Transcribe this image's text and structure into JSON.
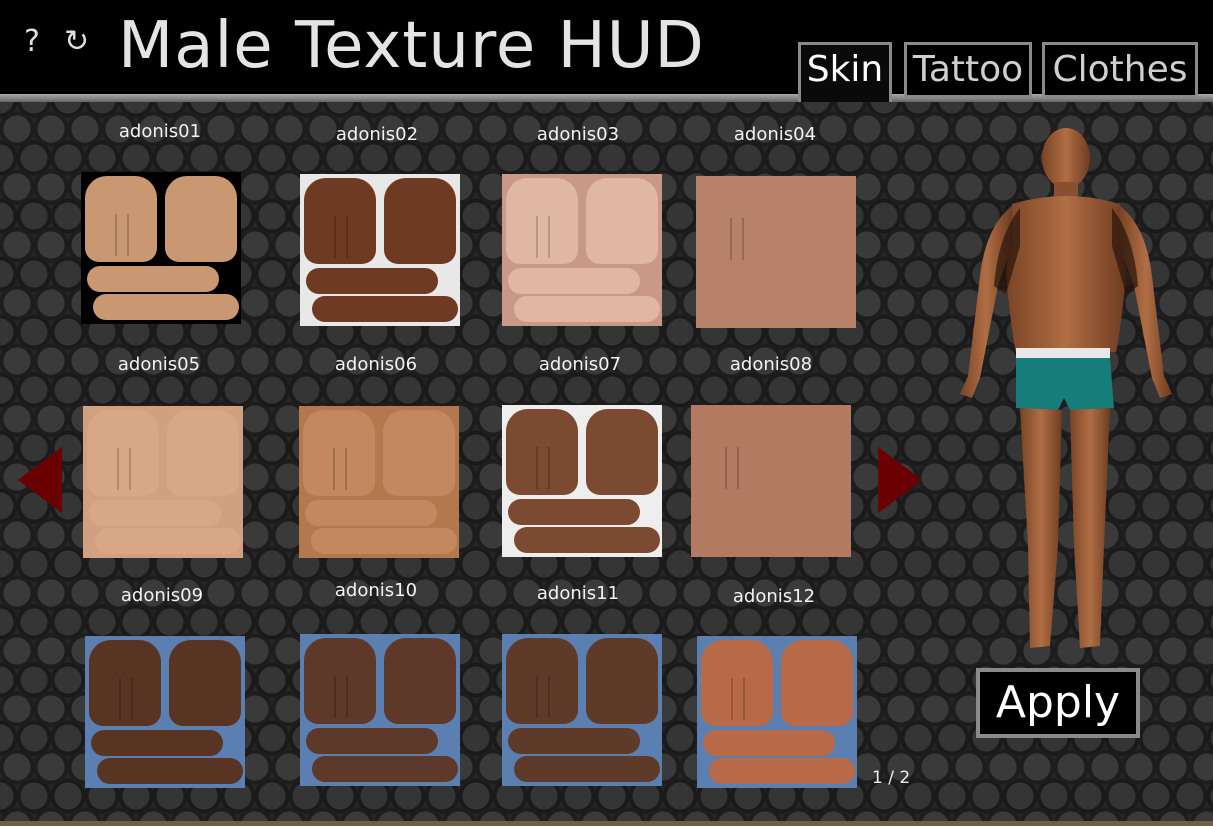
{
  "header": {
    "help_icon": "?",
    "refresh_icon": "↻",
    "title": "Male Texture HUD"
  },
  "tabs": [
    {
      "label": "Skin",
      "active": true
    },
    {
      "label": "Tattoo",
      "active": false
    },
    {
      "label": "Clothes",
      "active": false
    }
  ],
  "grid": {
    "items": [
      {
        "label": "adonis01",
        "tone": "#c99872",
        "bg": "#000000"
      },
      {
        "label": "adonis02",
        "tone": "#6e3a22",
        "bg": "#e8e8e8"
      },
      {
        "label": "adonis03",
        "tone": "#e0b7a2",
        "bg": "#c89a86"
      },
      {
        "label": "adonis04",
        "tone": "#b8826a",
        "bg": "#b8826a"
      },
      {
        "label": "adonis05",
        "tone": "#d8a886",
        "bg": "#d0a080"
      },
      {
        "label": "adonis06",
        "tone": "#c48860",
        "bg": "#b4784e"
      },
      {
        "label": "adonis07",
        "tone": "#7c4a30",
        "bg": "#eeeeee"
      },
      {
        "label": "adonis08",
        "tone": "#b27a60",
        "bg": "#b27a60"
      },
      {
        "label": "adonis09",
        "tone": "#5a3422",
        "bg": "#5a7fb0"
      },
      {
        "label": "adonis10",
        "tone": "#5e3828",
        "bg": "#5a7fb0"
      },
      {
        "label": "adonis11",
        "tone": "#603a28",
        "bg": "#5a7fb0"
      },
      {
        "label": "adonis12",
        "tone": "#b86a48",
        "bg": "#5a7fb0"
      }
    ]
  },
  "pagination": {
    "indicator": "1 / 2",
    "prev_icon": "triangle-left",
    "next_icon": "triangle-right"
  },
  "apply_label": "Apply",
  "colors": {
    "arrow": "#6a0000",
    "border": "#8a8a8a"
  }
}
